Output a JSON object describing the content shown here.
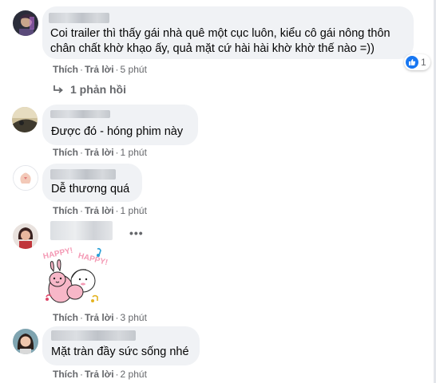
{
  "comments": [
    {
      "text_lines": [
        "Coi trailer thì thấy gái nhà quê một cục luôn, kiểu cô gái nông thôn",
        "chân chất khờ khạo ấy, quả mặt cứ hài hài khờ khờ thế nào =))"
      ],
      "actions": {
        "like": "Thích",
        "reply": "Trả lời",
        "time": "5 phút"
      },
      "reaction_count": "1",
      "reply_link": "1 phản hồi"
    },
    {
      "text_lines": [
        "Được đó - hóng phim này"
      ],
      "actions": {
        "like": "Thích",
        "reply": "Trả lời",
        "time": "1 phút"
      }
    },
    {
      "text_lines": [
        "Dễ thương quá"
      ],
      "actions": {
        "like": "Thích",
        "reply": "Trả lời",
        "time": "1 phút"
      }
    },
    {
      "text_lines": [],
      "sticker_text": [
        "HAPPY!",
        "HAPPY!"
      ],
      "actions": {
        "like": "Thích",
        "reply": "Trả lời",
        "time": "3 phút"
      },
      "more": "•••"
    },
    {
      "text_lines": [
        "Mặt tràn đầy sức sống nhé"
      ],
      "actions": {
        "like": "Thích",
        "reply": "Trả lời",
        "time": "2 phút"
      }
    }
  ],
  "icons": {
    "like": "thumbs-up-icon",
    "reply_arrow": "reply-arrow-icon",
    "more": "more-options-icon"
  },
  "colors": {
    "bubble": "#f0f2f5",
    "meta": "#65676b",
    "like_blue": "#1877f2",
    "sticker_pink": "#f49ab5"
  }
}
